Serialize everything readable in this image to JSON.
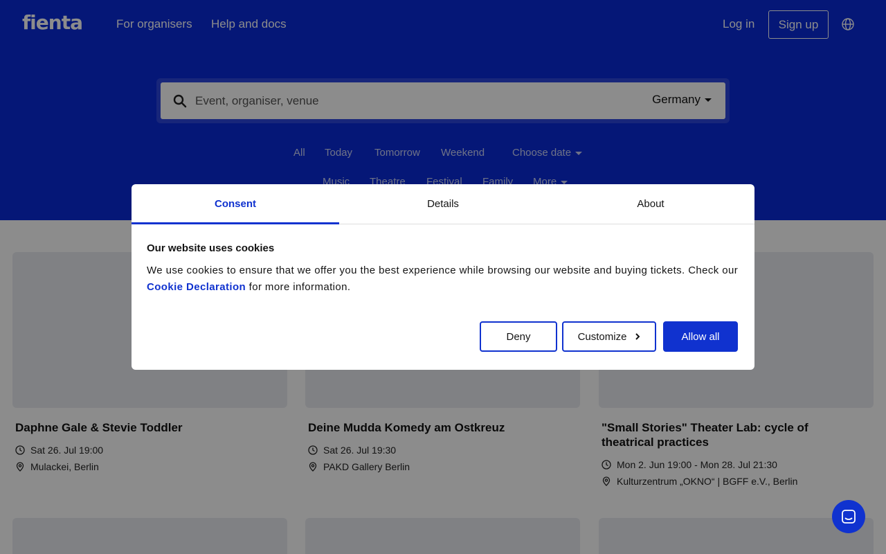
{
  "header": {
    "logo": "fienta",
    "nav": [
      "For organisers",
      "Help and docs"
    ],
    "login": "Log in",
    "signup": "Sign up"
  },
  "search": {
    "placeholder": "Event, organiser, venue",
    "country": "Germany"
  },
  "filters": {
    "time": [
      "All",
      "Today",
      "Tomorrow",
      "Weekend",
      "Choose date"
    ],
    "categories": [
      "Music",
      "Theatre",
      "Festival",
      "Family",
      "More"
    ]
  },
  "events": [
    {
      "title": "Daphne Gale & Stevie Toddler",
      "date": "Sat 26. Jul 19:00",
      "venue": "Mulackei, Berlin"
    },
    {
      "title": "Deine Mudda Komedy am Ostkreuz",
      "date": "Sat 26. Jul 19:30",
      "venue": "PAKD Gallery Berlin"
    },
    {
      "title": "\"Small Stories\" Theater Lab: cycle of theatrical practices",
      "date": "Mon 2. Jun 19:00 - Mon 28. Jul 21:30",
      "venue": "Kulturzentrum „OKNO“ | BGFF e.V., Berlin"
    }
  ],
  "consent": {
    "tabs": [
      "Consent",
      "Details",
      "About"
    ],
    "heading": "Our website uses cookies",
    "text_before": "We use cookies to ensure that we offer you the best experience while browsing our website and buying tickets. Check our ",
    "link": "Cookie Declaration",
    "text_after": " for more information.",
    "buttons": {
      "deny": "Deny",
      "customize": "Customize",
      "allow": "Allow all"
    }
  },
  "colors": {
    "brand": "#0a2ad9",
    "accent": "#1032cf"
  }
}
